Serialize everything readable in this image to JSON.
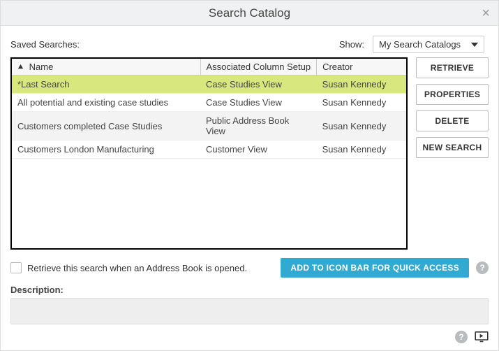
{
  "title": "Search Catalog",
  "saved_searches_label": "Saved Searches:",
  "show_label": "Show:",
  "show_value": "My Search Catalogs",
  "columns": {
    "name": "Name",
    "assoc": "Associated Column Setup",
    "creator": "Creator"
  },
  "rows": [
    {
      "name": "*Last Search",
      "assoc": "Case Studies View",
      "creator": "Susan Kennedy",
      "selected": true
    },
    {
      "name": "All potential and existing case studies",
      "assoc": "Case Studies View",
      "creator": "Susan Kennedy"
    },
    {
      "name": "Customers completed Case Studies",
      "assoc": "Public Address Book View",
      "creator": "Susan Kennedy",
      "alt": true
    },
    {
      "name": "Customers London Manufacturing",
      "assoc": "Customer View",
      "creator": "Susan Kennedy"
    }
  ],
  "actions": {
    "retrieve": "RETRIEVE",
    "properties": "PROPERTIES",
    "delete": "DELETE",
    "new_search": "NEW SEARCH"
  },
  "retrieve_on_open": "Retrieve this search when an Address Book is opened.",
  "add_to_icon_bar": "ADD TO ICON BAR FOR QUICK ACCESS",
  "description_label": "Description:"
}
